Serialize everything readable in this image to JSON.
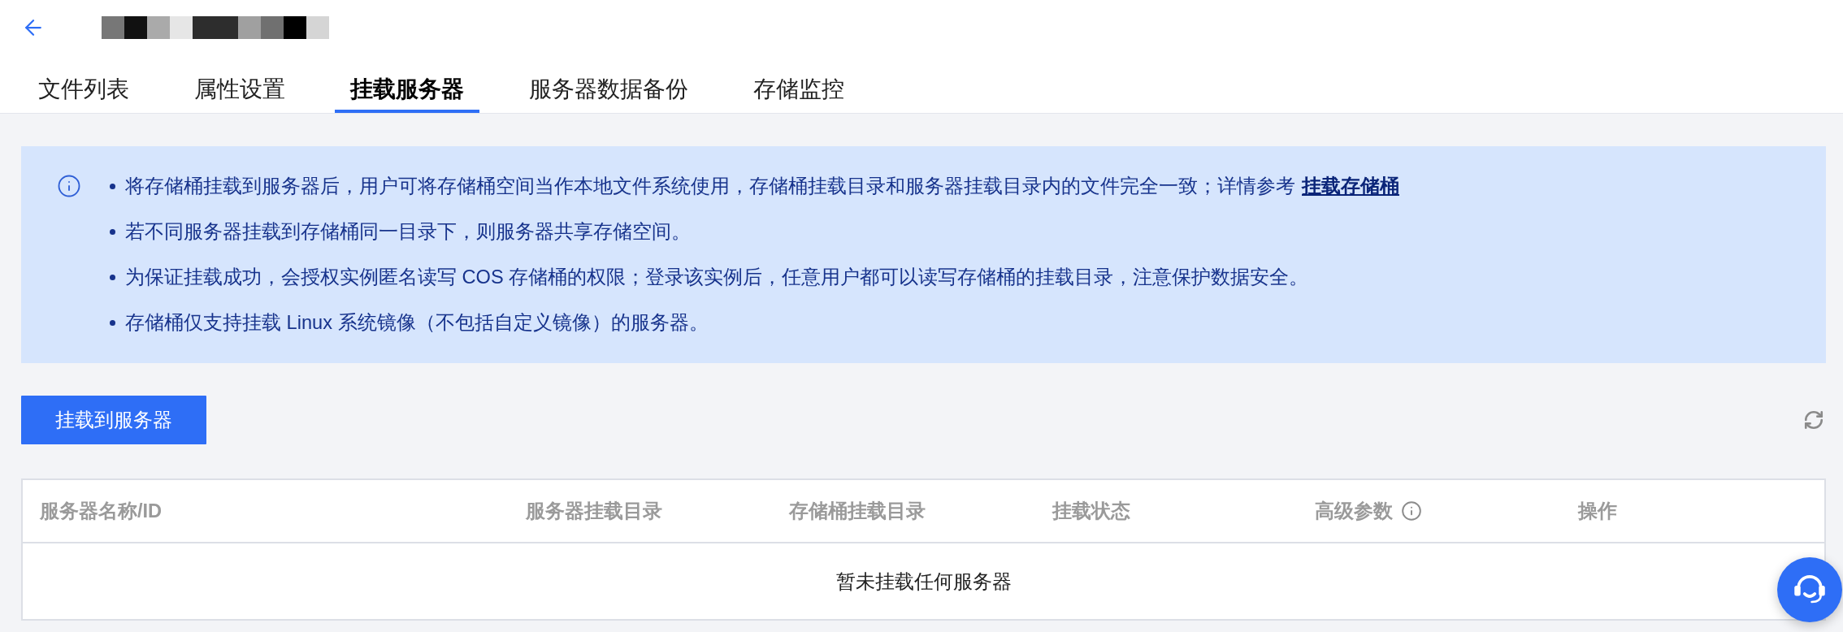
{
  "header": {
    "title_redacted": true
  },
  "tabs": [
    {
      "label": "文件列表",
      "selected": false
    },
    {
      "label": "属性设置",
      "selected": false
    },
    {
      "label": "挂载服务器",
      "selected": true
    },
    {
      "label": "服务器数据备份",
      "selected": false
    },
    {
      "label": "存储监控",
      "selected": false
    }
  ],
  "notice": {
    "items": [
      {
        "text": "将存储桶挂载到服务器后，用户可将存储桶空间当作本地文件系统使用，存储桶挂载目录和服务器挂载目录内的文件完全一致；详情参考",
        "link": "挂载存储桶"
      },
      {
        "text": "若不同服务器挂载到存储桶同一目录下，则服务器共享存储空间。"
      },
      {
        "text": "为保证挂载成功，会授权实例匿名读写 COS 存储桶的权限；登录该实例后，任意用户都可以读写存储桶的挂载目录，注意保护数据安全。"
      },
      {
        "text": "存储桶仅支持挂载 Linux 系统镜像（不包括自定义镜像）的服务器。"
      }
    ]
  },
  "toolbar": {
    "primary_button": "挂载到服务器"
  },
  "table": {
    "columns": [
      {
        "label": "服务器名称/ID",
        "info": false
      },
      {
        "label": "服务器挂载目录",
        "info": false
      },
      {
        "label": "存储桶挂载目录",
        "info": false
      },
      {
        "label": "挂载状态",
        "info": false
      },
      {
        "label": "高级参数",
        "info": true
      },
      {
        "label": "操作",
        "info": false
      }
    ],
    "empty_text": "暂未挂载任何服务器"
  }
}
